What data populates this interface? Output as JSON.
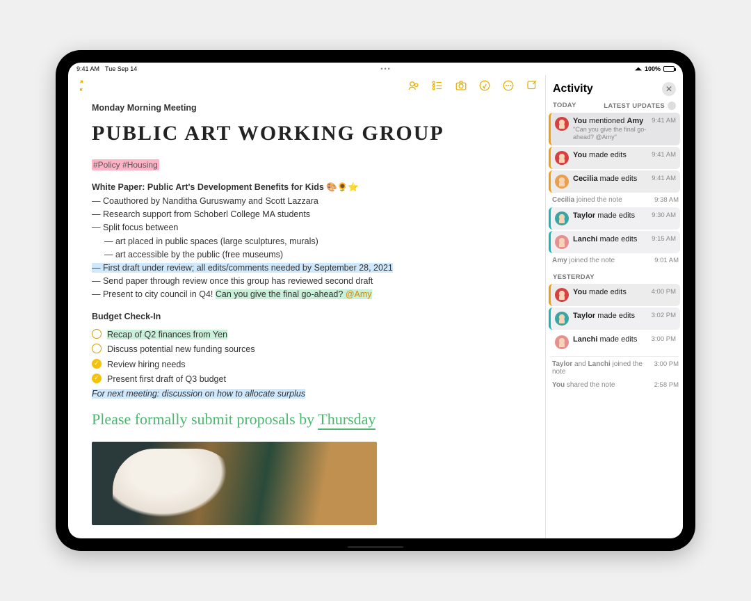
{
  "statusbar": {
    "time": "9:41 AM",
    "date": "Tue Sep 14",
    "battery": "100%"
  },
  "note": {
    "subtitle": "Monday Morning Meeting",
    "title": "PUBLIC ART WORKING GROUP",
    "tags": "#Policy #Housing",
    "wp_head": "White Paper: Public Art's Development Benefits for Kids 🎨🌻⭐",
    "b1": "— Coauthored by Nanditha Guruswamy and Scott Lazzara",
    "b2": "— Research support from Schoberl College MA students",
    "b3": "— Split focus between",
    "b3a": "— art placed in public spaces (large sculptures, murals)",
    "b3b": "— art accessible by the public (free museums)",
    "b4": "— First draft under review; all edits/comments needed by September 28, 2021",
    "b5": "— Send paper through review once this group has reviewed second draft",
    "b6a": "— Present to city council in Q4! ",
    "b6b": "Can you give the final go-ahead? ",
    "b6c": "@Amy",
    "budget_head": "Budget Check-In",
    "c1": "Recap of Q2 finances from Yen",
    "c2": "Discuss potential new funding sources",
    "c3": "Review hiring needs",
    "c4": "Present first draft of Q3 budget",
    "next": "For next meeting: discussion on how to allocate surplus",
    "hand1": "Please formally submit proposals by ",
    "hand2": "Thursday"
  },
  "activity": {
    "title": "Activity",
    "today": "TODAY",
    "latest": "LATEST UPDATES",
    "yesterday": "YESTERDAY",
    "items_today_main": [
      {
        "who_b": "You",
        "rest": " mentioned ",
        "whom_b": "Amy",
        "sub": "\"Can you give the final go-ahead? @Amy\"",
        "time": "9:41 AM",
        "accent": "orange",
        "av": "red",
        "top": true
      },
      {
        "who_b": "You",
        "rest": " made edits",
        "time": "9:41 AM",
        "accent": "orange",
        "av": "red"
      },
      {
        "who_b": "Cecilia",
        "rest": " made edits",
        "time": "9:41 AM",
        "accent": "orange",
        "av": "orange"
      }
    ],
    "today_join1": {
      "text": "Cecilia joined the note",
      "who": "Cecilia",
      "time": "9:38 AM"
    },
    "items_today_sec": [
      {
        "who_b": "Taylor",
        "rest": " made edits",
        "time": "9:30 AM",
        "accent": "teal",
        "av": "teal"
      },
      {
        "who_b": "Lanchi",
        "rest": " made edits",
        "time": "9:15 AM",
        "accent": "teal",
        "av": "pink"
      }
    ],
    "today_join2": {
      "text": "Amy joined the note",
      "who": "Amy",
      "time": "9:01 AM"
    },
    "items_yesterday": [
      {
        "who_b": "You",
        "rest": " made edits",
        "time": "4:00 PM",
        "accent": "orange",
        "av": "red"
      },
      {
        "who_b": "Taylor",
        "rest": " made edits",
        "time": "3:02 PM",
        "accent": "teal",
        "av": "teal"
      },
      {
        "who_b": "Lanchi",
        "rest": " made edits",
        "time": "3:00 PM",
        "accent": "plain",
        "av": "pink"
      }
    ],
    "foot1": {
      "text": "Taylor and Lanchi joined the note",
      "time": "3:00 PM"
    },
    "foot2": {
      "text": "You shared the note",
      "time": "2:58 PM"
    }
  }
}
